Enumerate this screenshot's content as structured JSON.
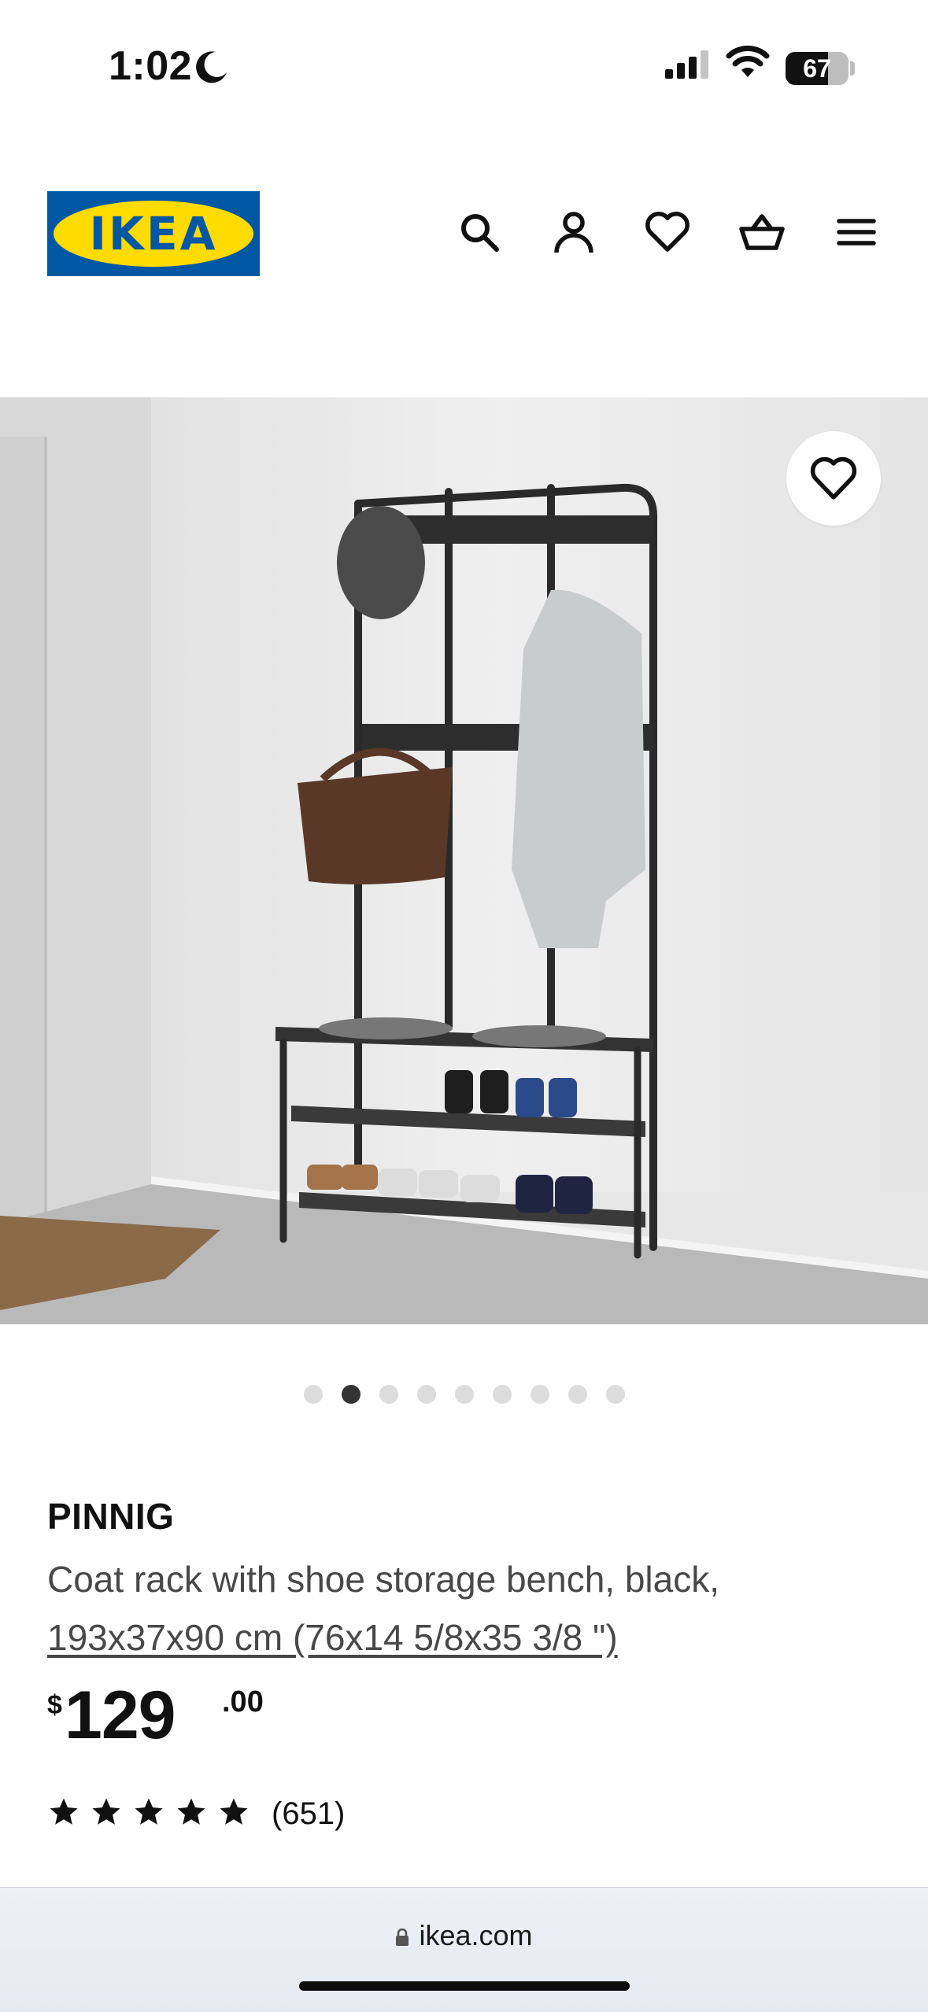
{
  "status_bar": {
    "time": "1:02",
    "battery": "67"
  },
  "header": {
    "logo_text": "IKEA",
    "icons": [
      "search-icon",
      "account-icon",
      "favorites-heart-icon",
      "shopping-basket-icon",
      "menu-icon"
    ]
  },
  "gallery": {
    "dot_count": 9,
    "active_index": 1
  },
  "product": {
    "name": "PINNIG",
    "description": "Coat rack with shoe storage bench, black,",
    "dimensions": "193x37x90 cm (76x14 5/8x35 3/8 \")",
    "price_currency": "$",
    "price_integer": "129",
    "price_decimal": ".00",
    "rating": 5,
    "reviews": "(651)"
  },
  "browser": {
    "url": "ikea.com"
  },
  "colors": {
    "brand_blue": "#0058a3",
    "brand_yellow": "#ffdb00"
  }
}
